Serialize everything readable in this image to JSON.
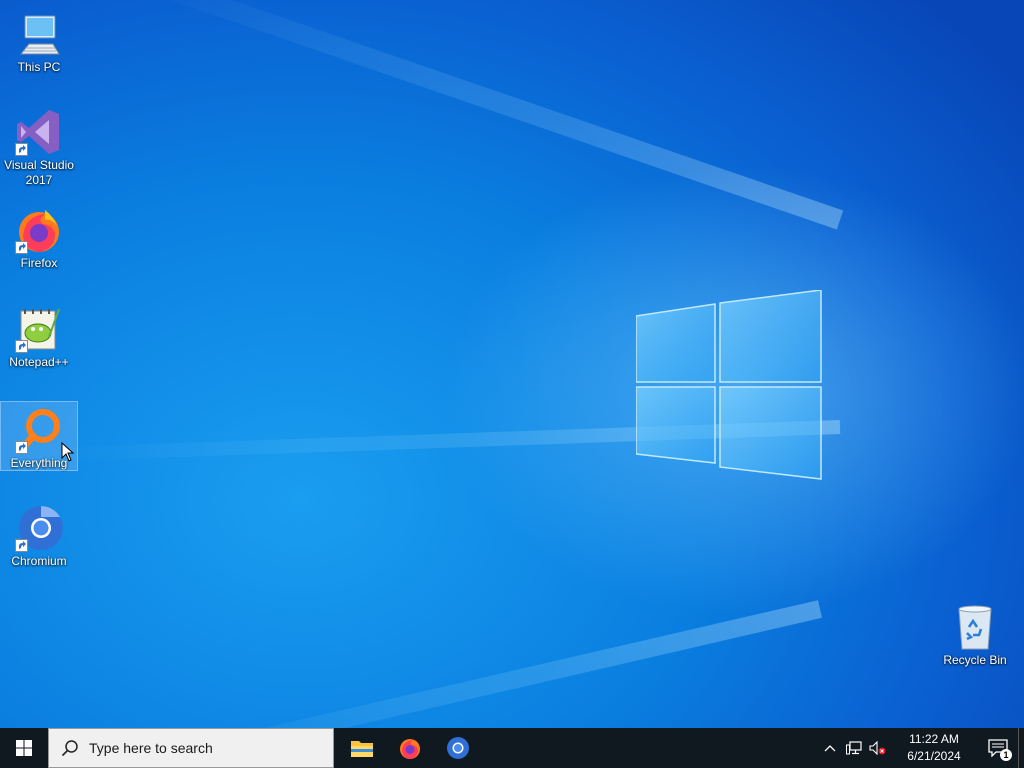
{
  "desktop": {
    "icons": [
      {
        "label": "This PC"
      },
      {
        "label": "Visual Studio\n2017"
      },
      {
        "label": "Firefox"
      },
      {
        "label": "Notepad++"
      },
      {
        "label": "Everything"
      },
      {
        "label": "Chromium"
      }
    ],
    "recycle_bin": {
      "label": "Recycle Bin"
    }
  },
  "taskbar": {
    "search_placeholder": "Type here to search",
    "pinned_apps": [
      "File Explorer",
      "Firefox",
      "Chromium"
    ],
    "clock": {
      "time": "11:22 AM",
      "date": "6/21/2024"
    },
    "notification_count": "1"
  },
  "colors": {
    "accent": "#0a7fe0",
    "taskbar": "#101820",
    "search_box": "#f0f0f0"
  }
}
